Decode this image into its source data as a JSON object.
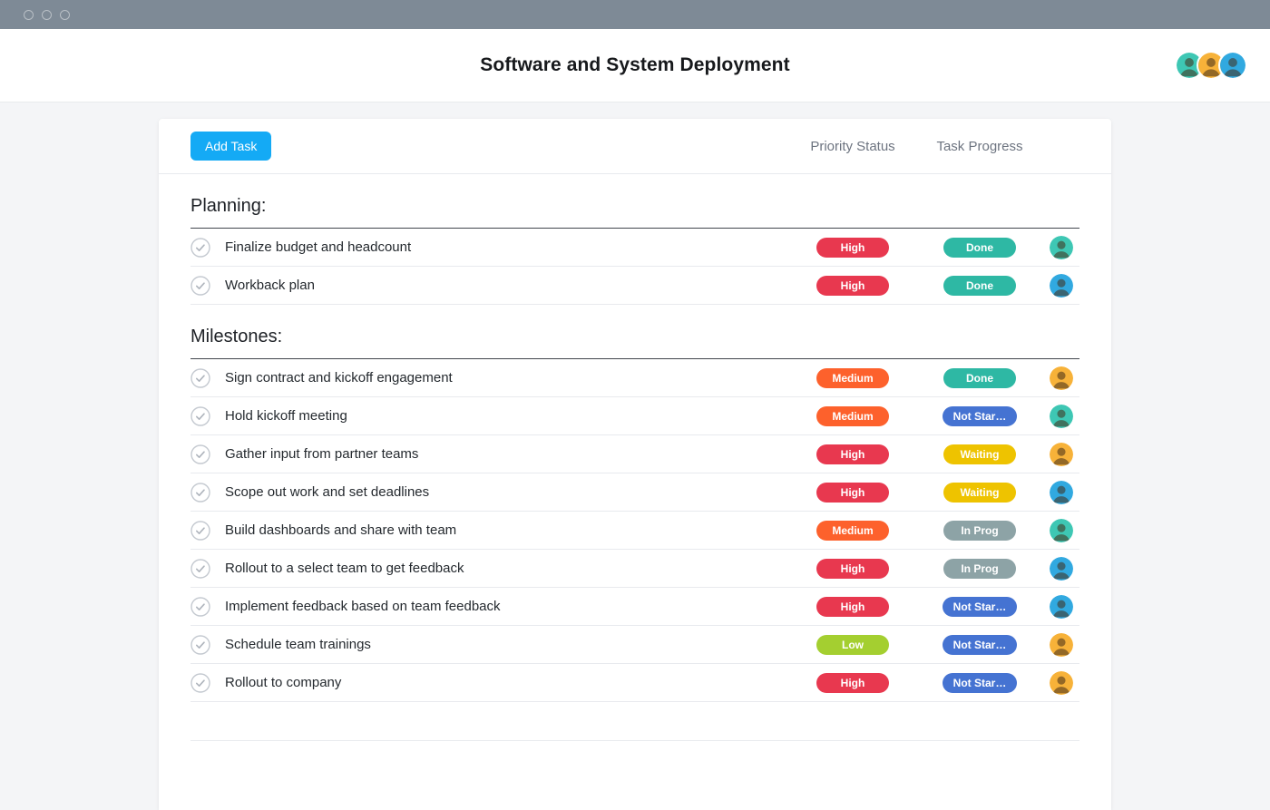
{
  "window": {
    "controls": [
      "close",
      "minimize",
      "zoom"
    ]
  },
  "header": {
    "title": "Software and System Deployment",
    "avatars": [
      "teal",
      "yellow",
      "blue"
    ]
  },
  "toolbar": {
    "add_task_label": "Add Task",
    "columns": [
      "Priority Status",
      "Task Progress"
    ]
  },
  "palette": {
    "priority": {
      "High": "#e8384f",
      "Medium": "#fd612c",
      "Low": "#a4cf30"
    },
    "status": {
      "Done": "#2eb8a4",
      "Not Star…": "#4573d2",
      "Waiting": "#eec300",
      "In Prog": "#8da3a6"
    },
    "avatar": {
      "teal": "#3ec7b4",
      "yellow": "#f7b239",
      "blue": "#31a9e0"
    },
    "accent_blue": "#14aaf5"
  },
  "sections": [
    {
      "title": "Planning:",
      "tasks": [
        {
          "name": "Finalize budget and headcount",
          "priority": "High",
          "status": "Done",
          "avatar": "teal"
        },
        {
          "name": "Workback plan",
          "priority": "High",
          "status": "Done",
          "avatar": "blue"
        }
      ]
    },
    {
      "title": "Milestones:",
      "tasks": [
        {
          "name": "Sign contract and kickoff engagement",
          "priority": "Medium",
          "status": "Done",
          "avatar": "yellow"
        },
        {
          "name": "Hold kickoff meeting",
          "priority": "Medium",
          "status": "Not Star…",
          "avatar": "teal"
        },
        {
          "name": "Gather input from partner teams",
          "priority": "High",
          "status": "Waiting",
          "avatar": "yellow"
        },
        {
          "name": "Scope out work and set deadlines",
          "priority": "High",
          "status": "Waiting",
          "avatar": "blue"
        },
        {
          "name": "Build dashboards and share with team",
          "priority": "Medium",
          "status": "In Prog",
          "avatar": "teal"
        },
        {
          "name": "Rollout to a select team to get feedback",
          "priority": "High",
          "status": "In Prog",
          "avatar": "blue"
        },
        {
          "name": "Implement feedback based on team feedback",
          "priority": "High",
          "status": "Not Star…",
          "avatar": "blue"
        },
        {
          "name": "Schedule team trainings",
          "priority": "Low",
          "status": "Not Star…",
          "avatar": "yellow"
        },
        {
          "name": "Rollout to company",
          "priority": "High",
          "status": "Not Star…",
          "avatar": "yellow"
        }
      ]
    }
  ]
}
